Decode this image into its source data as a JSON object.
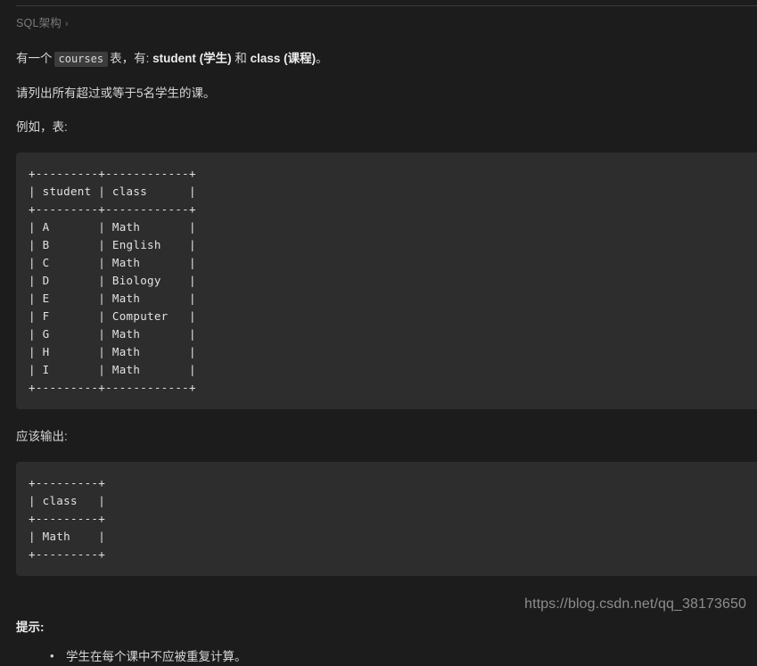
{
  "breadcrumb": {
    "label": "SQL架构",
    "chevron": "›"
  },
  "paragraphs": {
    "intro_part1": "有一个",
    "intro_code": "courses",
    "intro_part2": "表，有: ",
    "intro_bold1": "student (学生)",
    "intro_mid": " 和 ",
    "intro_bold2": "class (课程)",
    "intro_end": "。",
    "requirement": "请列出所有超过或等于5名学生的课。",
    "example_label": "例如，表:",
    "output_label": "应该输出:"
  },
  "example_table": {
    "lines": [
      "+---------+------------+",
      "| student | class      |",
      "+---------+------------+",
      "| A       | Math       |",
      "| B       | English    |",
      "| C       | Math       |",
      "| D       | Biology    |",
      "| E       | Math       |",
      "| F       | Computer   |",
      "| G       | Math       |",
      "| H       | Math       |",
      "| I       | Math       |",
      "+---------+------------+"
    ],
    "text": "+---------+------------+\n| student | class      |\n+---------+------------+\n| A       | Math       |\n| B       | English    |\n| C       | Math       |\n| D       | Biology    |\n| E       | Math       |\n| F       | Computer   |\n| G       | Math       |\n| H       | Math       |\n| I       | Math       |\n+---------+------------+"
  },
  "output_table": {
    "lines": [
      "+---------+",
      "| class   |",
      "+---------+",
      "| Math    |",
      "+---------+"
    ],
    "text": "+---------+\n| class   |\n+---------+\n| Math    |\n+---------+"
  },
  "hint": {
    "title": "提示:",
    "items": [
      "学生在每个课中不应被重复计算。"
    ]
  },
  "watermark": {
    "text": "https://blog.csdn.net/qq_38173650"
  },
  "colors": {
    "page_background": "#1c1c1c",
    "code_background": "#2d2d2d",
    "text": "#d6d6d6",
    "muted_text": "#7a7a7a",
    "inline_code_background": "#3c3c3c",
    "watermark": "#8d8d8d",
    "divider": "#3a3a3a"
  }
}
